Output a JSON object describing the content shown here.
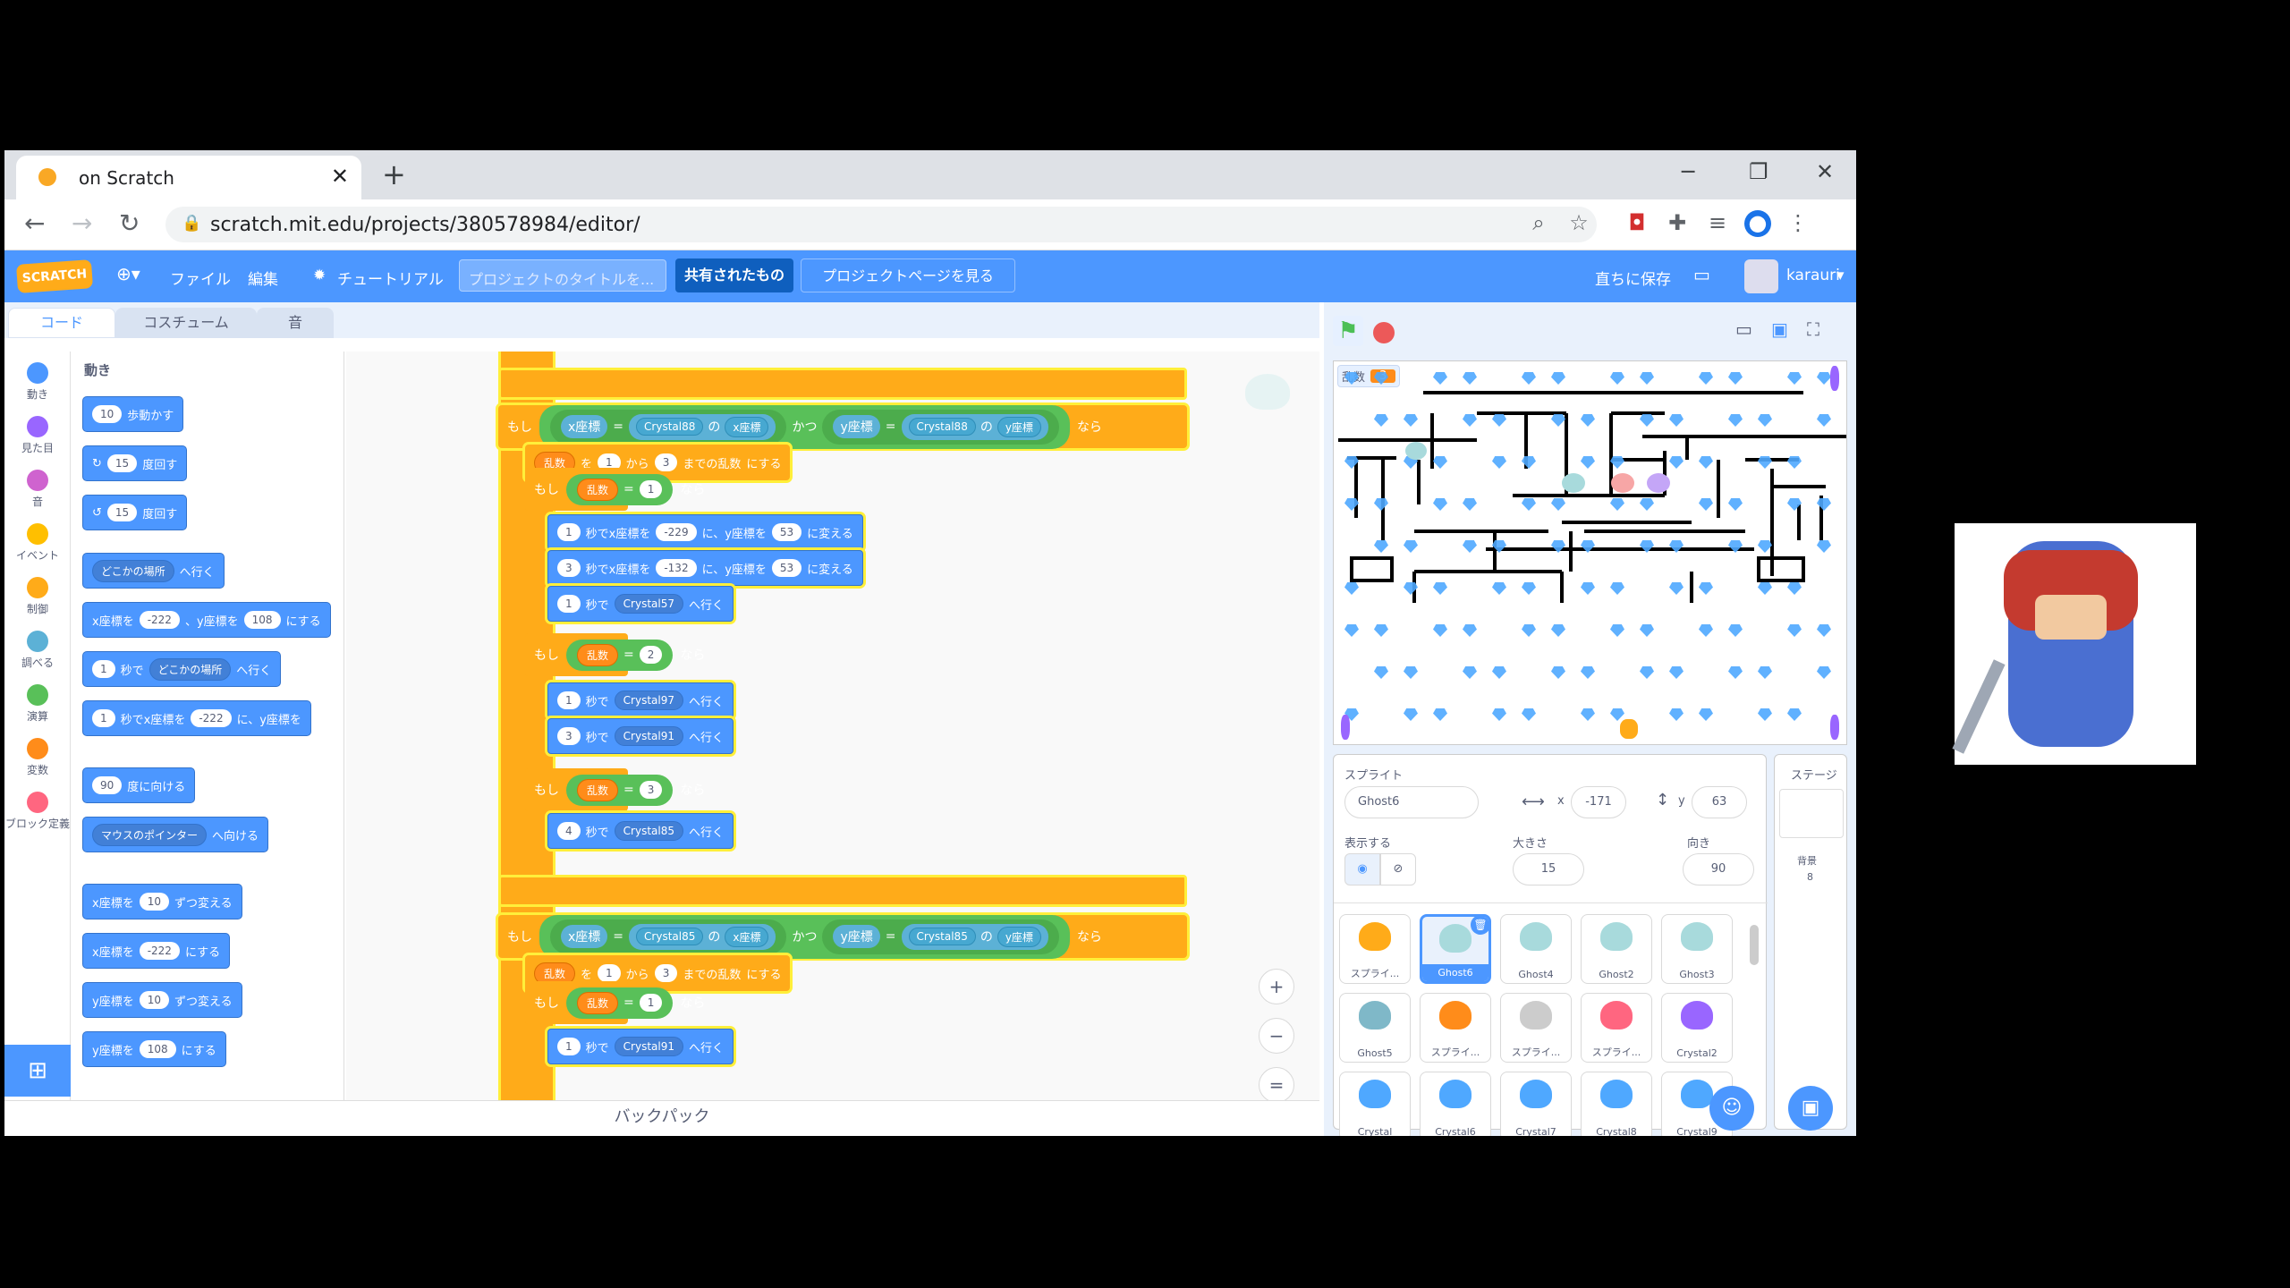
{
  "browser": {
    "tab_title": "on Scratch",
    "url": "scratch.mit.edu/projects/380578984/editor/",
    "close_tab": "✕",
    "new_tab": "+",
    "minimize": "─",
    "restore": "❐",
    "close_window": "✕",
    "back": "←",
    "forward": "→",
    "reload": "↻"
  },
  "menu": {
    "logo": "SCRATCH",
    "file": "ファイル",
    "edit": "編集",
    "tutorial": "チュートリアル",
    "title_placeholder": "プロジェクトのタイトルを...",
    "shared": "共有されたもの",
    "project_page": "プロジェクトページを見る",
    "save_now": "直ちに保存",
    "user": "karauri"
  },
  "editor_tabs": {
    "code": "コード",
    "costume": "コスチューム",
    "sound": "音"
  },
  "categories": [
    {
      "label": "動き",
      "color": "#4c97ff"
    },
    {
      "label": "見た目",
      "color": "#9966ff"
    },
    {
      "label": "音",
      "color": "#cf63cf"
    },
    {
      "label": "イベント",
      "color": "#ffbf00"
    },
    {
      "label": "制御",
      "color": "#ffab19"
    },
    {
      "label": "調べる",
      "color": "#5cb1d6"
    },
    {
      "label": "演算",
      "color": "#59c059"
    },
    {
      "label": "変数",
      "color": "#ff8c1a"
    },
    {
      "label": "ブロック定義",
      "color": "#ff6680"
    }
  ],
  "palette": {
    "heading": "動き",
    "move_n": "10",
    "move_t": "歩動かす",
    "turn_r_n": "15",
    "turn_r_t": "度回す",
    "turn_l_n": "15",
    "turn_l_t": "度回す",
    "goto_dd": "どこかの場所",
    "goto_t": "へ行く",
    "setxy_a": "x座標を",
    "setxy_x": "-222",
    "setxy_b": "、y座標を",
    "setxy_y": "108",
    "setxy_c": "にする",
    "glide_n": "1",
    "glide_a": "秒で",
    "glide_dd": "どこかの場所",
    "glide_b": "へ行く",
    "glidexy_n": "1",
    "glidexy_a": "秒でx座標を",
    "glidexy_x": "-222",
    "glidexy_b": "に、y座標を",
    "point_n": "90",
    "point_t": "度に向ける",
    "towards_dd": "マウスのポインター",
    "towards_t": "へ向ける",
    "chx_a": "x座標を",
    "chx_n": "10",
    "chx_b": "ずつ変える",
    "setx_a": "x座標を",
    "setx_n": "-222",
    "setx_b": "にする",
    "chy_a": "y座標を",
    "chy_n": "10",
    "chy_b": "ずつ変える",
    "sety_a": "y座標を",
    "sety_n": "108",
    "sety_b": "にする"
  },
  "script": {
    "if1": {
      "kw": "もし",
      "xlbl": "x座標",
      "eq": "=",
      "sprite": "Crystal88",
      "of": "の",
      "prop": "x座標",
      "and": "かつ",
      "ylbl": "y座標",
      "sprite2": "Crystal88",
      "prop2": "y座標",
      "then": "なら"
    },
    "rand1": {
      "var": "乱数",
      "to": "を",
      "from": "1",
      "kara": "から",
      "to_n": "3",
      "made": "までの乱数",
      "suru": "にする"
    },
    "ifr1": {
      "kw": "もし",
      "var": "乱数",
      "eq": "=",
      "n": "1",
      "then": "なら"
    },
    "g1": {
      "n": "1",
      "a": "秒でx座標を",
      "x": "-229",
      "b": "に、y座標を",
      "y": "53",
      "c": "に変える"
    },
    "g2": {
      "n": "3",
      "a": "秒でx座標を",
      "x": "-132",
      "b": "に、y座標を",
      "y": "53",
      "c": "に変える"
    },
    "g3": {
      "n": "1",
      "a": "秒で",
      "dd": "Crystal57",
      "b": "へ行く"
    },
    "ifr2": {
      "kw": "もし",
      "var": "乱数",
      "eq": "=",
      "n": "2",
      "then": "なら"
    },
    "g4": {
      "n": "1",
      "a": "秒で",
      "dd": "Crystal97",
      "b": "へ行く"
    },
    "g5": {
      "n": "3",
      "a": "秒で",
      "dd": "Crystal91",
      "b": "へ行く"
    },
    "ifr3": {
      "kw": "もし",
      "var": "乱数",
      "eq": "=",
      "n": "3",
      "then": "なら"
    },
    "g6": {
      "n": "4",
      "a": "秒で",
      "dd": "Crystal85",
      "b": "へ行く"
    },
    "if2": {
      "kw": "もし",
      "xlbl": "x座標",
      "eq": "=",
      "sprite": "Crystal85",
      "of": "の",
      "prop": "x座標",
      "and": "かつ",
      "ylbl": "y座標",
      "sprite2": "Crystal85",
      "prop2": "y座標",
      "then": "なら"
    },
    "rand2": {
      "var": "乱数",
      "to": "を",
      "from": "1",
      "kara": "から",
      "to_n": "3",
      "made": "までの乱数",
      "suru": "にする"
    },
    "ifr4": {
      "kw": "もし",
      "var": "乱数",
      "eq": "=",
      "n": "1",
      "then": "なら"
    },
    "g7": {
      "n": "1",
      "a": "秒で",
      "dd": "Crystal91",
      "b": "へ行く"
    }
  },
  "backpack": "バックパック",
  "stage": {
    "var_name": "乱数",
    "var_value": "3"
  },
  "sprite_info": {
    "sprite_label": "スプライト",
    "name": "Ghost6",
    "x_label": "x",
    "x": "-171",
    "y_label": "y",
    "y": "63",
    "show_label": "表示する",
    "size_label": "大きさ",
    "size": "15",
    "dir_label": "向き",
    "dir": "90"
  },
  "stage_col": {
    "title": "ステージ",
    "bg_label": "背景",
    "bg_count": "8"
  },
  "sprites": [
    {
      "name": "スプライ...",
      "color": "#ffab19"
    },
    {
      "name": "Ghost6",
      "color": "#a8dadc",
      "selected": true
    },
    {
      "name": "Ghost4",
      "color": "#a8dadc"
    },
    {
      "name": "Ghost2",
      "color": "#a8dadc"
    },
    {
      "name": "Ghost3",
      "color": "#a8dadc"
    },
    {
      "name": "Ghost5",
      "color": "#7fb8c8"
    },
    {
      "name": "スプライ...",
      "color": "#ff8c1a"
    },
    {
      "name": "スプライ...",
      "color": "#cccccc"
    },
    {
      "name": "スプライ...",
      "color": "#ff6680"
    },
    {
      "name": "Crystal2",
      "color": "#9966ff"
    },
    {
      "name": "Crystal",
      "color": "#4fa8ff"
    },
    {
      "name": "Crystal6",
      "color": "#4fa8ff"
    },
    {
      "name": "Crystal7",
      "color": "#4fa8ff"
    },
    {
      "name": "Crystal8",
      "color": "#4fa8ff"
    },
    {
      "name": "Crystal9",
      "color": "#4fa8ff"
    }
  ]
}
